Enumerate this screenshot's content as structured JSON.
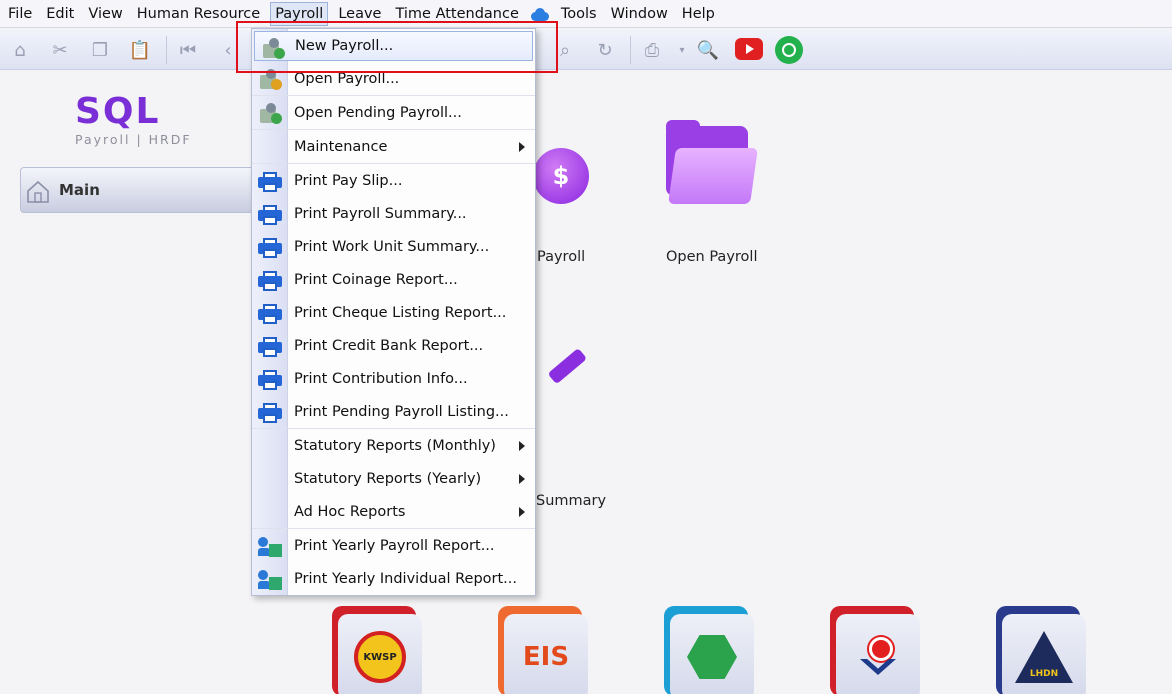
{
  "menubar": {
    "items": [
      "File",
      "Edit",
      "View",
      "Human Resource",
      "Payroll",
      "Leave",
      "Time Attendance",
      "Tools",
      "Window",
      "Help"
    ],
    "active": "Payroll"
  },
  "logo": {
    "brand": "SQL",
    "subtitle": "Payroll | HRDF"
  },
  "sidebar": {
    "main_label": "Main"
  },
  "background_labels": {
    "payroll": "Payroll",
    "open_payroll": "Open Payroll",
    "summary": "Summary"
  },
  "bottom_cards": {
    "kwsp": "KWSP",
    "eis": "EIS",
    "lhdn": "LHDN"
  },
  "dropdown": {
    "items": [
      {
        "label": "New Payroll...",
        "icon": "new-payroll-icon",
        "highlight": true
      },
      {
        "label": "Open Payroll...",
        "icon": "open-payroll-icon"
      },
      {
        "label": "Open Pending Payroll...",
        "icon": "pending-payroll-icon"
      },
      {
        "label": "Maintenance",
        "submenu": true
      },
      {
        "label": "Print Pay Slip...",
        "icon": "printer-icon"
      },
      {
        "label": "Print Payroll Summary...",
        "icon": "printer-icon"
      },
      {
        "label": "Print Work Unit Summary...",
        "icon": "printer-icon"
      },
      {
        "label": "Print Coinage Report...",
        "icon": "printer-icon"
      },
      {
        "label": "Print Cheque Listing Report...",
        "icon": "printer-icon"
      },
      {
        "label": "Print Credit Bank Report...",
        "icon": "printer-icon"
      },
      {
        "label": "Print Contribution Info...",
        "icon": "printer-icon"
      },
      {
        "label": "Print Pending Payroll Listing...",
        "icon": "printer-icon"
      },
      {
        "label": "Statutory Reports (Monthly)",
        "submenu": true
      },
      {
        "label": "Statutory Reports (Yearly)",
        "submenu": true
      },
      {
        "label": "Ad Hoc Reports",
        "submenu": true
      },
      {
        "label": "Print Yearly Payroll Report...",
        "icon": "report-icon"
      },
      {
        "label": "Print Yearly Individual Report...",
        "icon": "report-icon"
      }
    ]
  },
  "colors": {
    "accent": "#7a2fd6",
    "highlight_border": "#e0101a"
  }
}
